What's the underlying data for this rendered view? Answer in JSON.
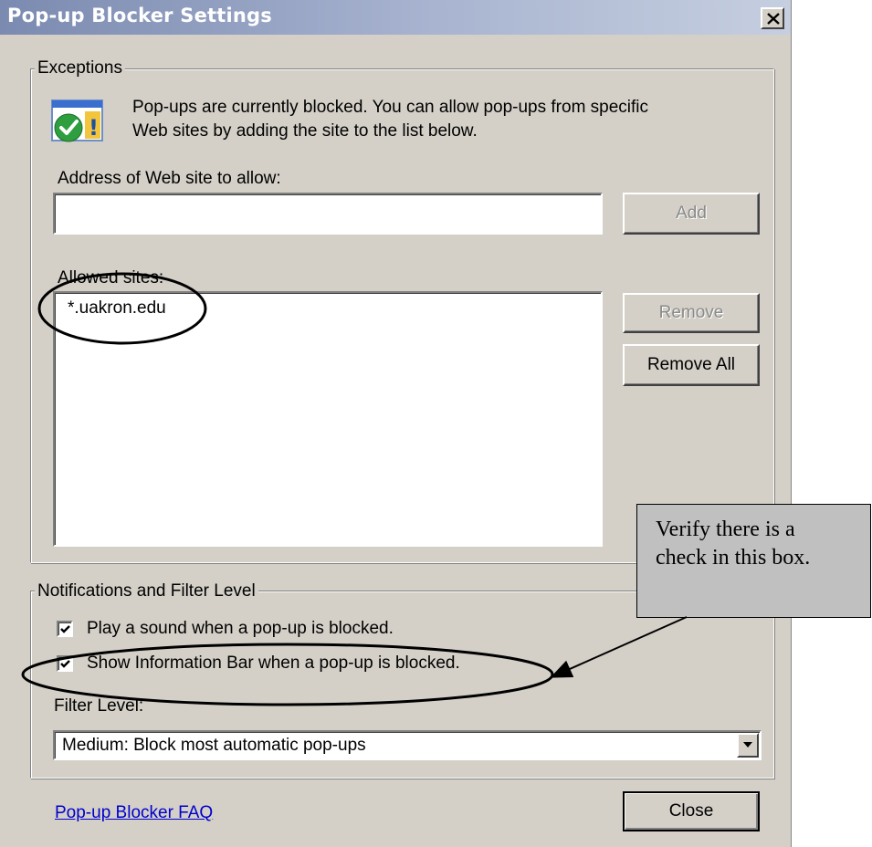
{
  "window": {
    "title": "Pop-up Blocker Settings"
  },
  "exceptions": {
    "legend": "Exceptions",
    "info_text_line1": "Pop-ups are currently blocked.  You can allow pop-ups from specific",
    "info_text_line2": "Web sites by adding the site to the list below.",
    "address_label": "Address of Web site to allow:",
    "address_value": "",
    "add_button": "Add",
    "allowed_sites_label": "Allowed sites:",
    "allowed_sites": [
      "*.uakron.edu"
    ],
    "remove_button": "Remove",
    "remove_all_button": "Remove All"
  },
  "notifications": {
    "legend": "Notifications and Filter Level",
    "play_sound_label": "Play a sound when a pop-up is blocked.",
    "play_sound_checked": true,
    "show_info_bar_label": "Show Information Bar when a pop-up is blocked.",
    "show_info_bar_checked": true,
    "filter_level_label": "Filter Level:",
    "filter_level_value": "Medium: Block most automatic pop-ups"
  },
  "footer": {
    "faq_link": "Pop-up Blocker FAQ",
    "close_button": "Close"
  },
  "callout": {
    "line1": "Verify there is a",
    "line2": "check in this box."
  },
  "icons": {
    "info_icon": "shield-warning-icon",
    "close": "close-icon",
    "dropdown": "chevron-down-icon",
    "check": "checkmark-icon"
  }
}
